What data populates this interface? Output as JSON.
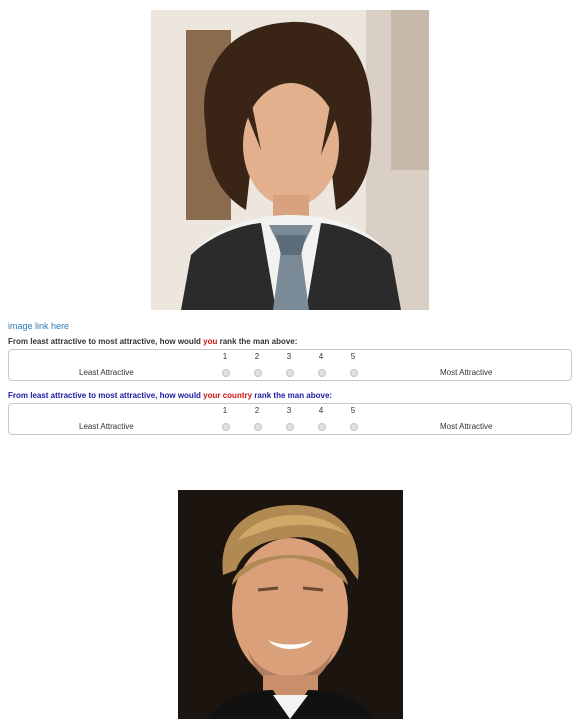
{
  "image_link": "image link here",
  "question1": {
    "before": "From least attractive to most attractive, how would ",
    "highlight": "you",
    "after": " rank the man above:"
  },
  "question2": {
    "before": "From least attractive to most attractive, how would ",
    "highlight": "your country",
    "after": " rank the man above:"
  },
  "scale": {
    "left_label": "Least Attractive",
    "right_label": "Most Attractive",
    "options": [
      "1",
      "2",
      "3",
      "4",
      "5"
    ]
  },
  "colors": {
    "link": "#2a7ab8",
    "highlight": "#cc1111",
    "question2_text": "#1a1aa0"
  }
}
